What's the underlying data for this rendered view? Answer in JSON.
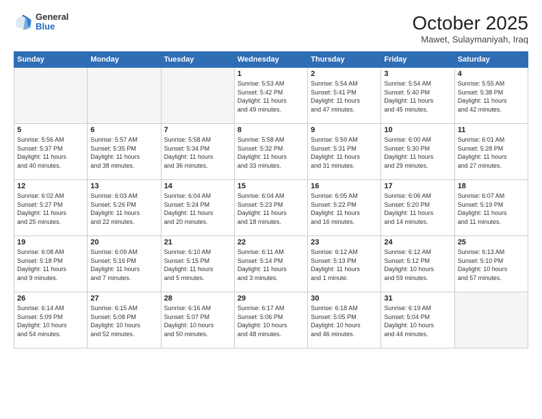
{
  "logo": {
    "general": "General",
    "blue": "Blue"
  },
  "header": {
    "month": "October 2025",
    "location": "Mawet, Sulaymaniyah, Iraq"
  },
  "days_of_week": [
    "Sunday",
    "Monday",
    "Tuesday",
    "Wednesday",
    "Thursday",
    "Friday",
    "Saturday"
  ],
  "weeks": [
    [
      {
        "day": "",
        "info": ""
      },
      {
        "day": "",
        "info": ""
      },
      {
        "day": "",
        "info": ""
      },
      {
        "day": "1",
        "info": "Sunrise: 5:53 AM\nSunset: 5:42 PM\nDaylight: 11 hours\nand 49 minutes."
      },
      {
        "day": "2",
        "info": "Sunrise: 5:54 AM\nSunset: 5:41 PM\nDaylight: 11 hours\nand 47 minutes."
      },
      {
        "day": "3",
        "info": "Sunrise: 5:54 AM\nSunset: 5:40 PM\nDaylight: 11 hours\nand 45 minutes."
      },
      {
        "day": "4",
        "info": "Sunrise: 5:55 AM\nSunset: 5:38 PM\nDaylight: 11 hours\nand 42 minutes."
      }
    ],
    [
      {
        "day": "5",
        "info": "Sunrise: 5:56 AM\nSunset: 5:37 PM\nDaylight: 11 hours\nand 40 minutes."
      },
      {
        "day": "6",
        "info": "Sunrise: 5:57 AM\nSunset: 5:35 PM\nDaylight: 11 hours\nand 38 minutes."
      },
      {
        "day": "7",
        "info": "Sunrise: 5:58 AM\nSunset: 5:34 PM\nDaylight: 11 hours\nand 36 minutes."
      },
      {
        "day": "8",
        "info": "Sunrise: 5:58 AM\nSunset: 5:32 PM\nDaylight: 11 hours\nand 33 minutes."
      },
      {
        "day": "9",
        "info": "Sunrise: 5:59 AM\nSunset: 5:31 PM\nDaylight: 11 hours\nand 31 minutes."
      },
      {
        "day": "10",
        "info": "Sunrise: 6:00 AM\nSunset: 5:30 PM\nDaylight: 11 hours\nand 29 minutes."
      },
      {
        "day": "11",
        "info": "Sunrise: 6:01 AM\nSunset: 5:28 PM\nDaylight: 11 hours\nand 27 minutes."
      }
    ],
    [
      {
        "day": "12",
        "info": "Sunrise: 6:02 AM\nSunset: 5:27 PM\nDaylight: 11 hours\nand 25 minutes."
      },
      {
        "day": "13",
        "info": "Sunrise: 6:03 AM\nSunset: 5:26 PM\nDaylight: 11 hours\nand 22 minutes."
      },
      {
        "day": "14",
        "info": "Sunrise: 6:04 AM\nSunset: 5:24 PM\nDaylight: 11 hours\nand 20 minutes."
      },
      {
        "day": "15",
        "info": "Sunrise: 6:04 AM\nSunset: 5:23 PM\nDaylight: 11 hours\nand 18 minutes."
      },
      {
        "day": "16",
        "info": "Sunrise: 6:05 AM\nSunset: 5:22 PM\nDaylight: 11 hours\nand 16 minutes."
      },
      {
        "day": "17",
        "info": "Sunrise: 6:06 AM\nSunset: 5:20 PM\nDaylight: 11 hours\nand 14 minutes."
      },
      {
        "day": "18",
        "info": "Sunrise: 6:07 AM\nSunset: 5:19 PM\nDaylight: 11 hours\nand 11 minutes."
      }
    ],
    [
      {
        "day": "19",
        "info": "Sunrise: 6:08 AM\nSunset: 5:18 PM\nDaylight: 11 hours\nand 9 minutes."
      },
      {
        "day": "20",
        "info": "Sunrise: 6:09 AM\nSunset: 5:16 PM\nDaylight: 11 hours\nand 7 minutes."
      },
      {
        "day": "21",
        "info": "Sunrise: 6:10 AM\nSunset: 5:15 PM\nDaylight: 11 hours\nand 5 minutes."
      },
      {
        "day": "22",
        "info": "Sunrise: 6:11 AM\nSunset: 5:14 PM\nDaylight: 11 hours\nand 3 minutes."
      },
      {
        "day": "23",
        "info": "Sunrise: 6:12 AM\nSunset: 5:13 PM\nDaylight: 11 hours\nand 1 minute."
      },
      {
        "day": "24",
        "info": "Sunrise: 6:12 AM\nSunset: 5:12 PM\nDaylight: 10 hours\nand 59 minutes."
      },
      {
        "day": "25",
        "info": "Sunrise: 6:13 AM\nSunset: 5:10 PM\nDaylight: 10 hours\nand 57 minutes."
      }
    ],
    [
      {
        "day": "26",
        "info": "Sunrise: 6:14 AM\nSunset: 5:09 PM\nDaylight: 10 hours\nand 54 minutes."
      },
      {
        "day": "27",
        "info": "Sunrise: 6:15 AM\nSunset: 5:08 PM\nDaylight: 10 hours\nand 52 minutes."
      },
      {
        "day": "28",
        "info": "Sunrise: 6:16 AM\nSunset: 5:07 PM\nDaylight: 10 hours\nand 50 minutes."
      },
      {
        "day": "29",
        "info": "Sunrise: 6:17 AM\nSunset: 5:06 PM\nDaylight: 10 hours\nand 48 minutes."
      },
      {
        "day": "30",
        "info": "Sunrise: 6:18 AM\nSunset: 5:05 PM\nDaylight: 10 hours\nand 46 minutes."
      },
      {
        "day": "31",
        "info": "Sunrise: 6:19 AM\nSunset: 5:04 PM\nDaylight: 10 hours\nand 44 minutes."
      },
      {
        "day": "",
        "info": ""
      }
    ]
  ]
}
